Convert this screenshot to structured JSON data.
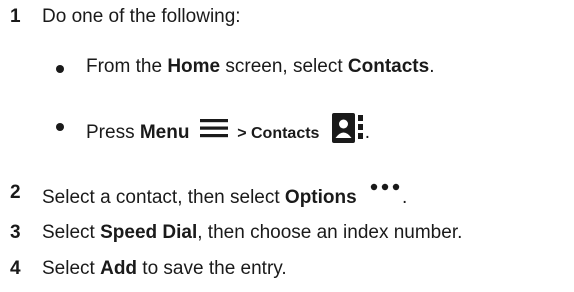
{
  "steps": [
    {
      "number": "1",
      "text": "Do one of the following:",
      "bullets": [
        {
          "prefix": "From the ",
          "bold1": "Home",
          "middle": " screen, select ",
          "bold2": "Contacts",
          "suffix": "."
        },
        {
          "prefix": "Press ",
          "bold1": "Menu",
          "icon1": "hamburger-menu-icon",
          "middle": " > ",
          "bold2": "Contacts",
          "icon2": "contacts-icon",
          "suffix": "."
        }
      ]
    },
    {
      "number": "2",
      "prefix": "Select a contact, then select ",
      "bold": "Options",
      "icon": "more-options-icon",
      "suffix": "."
    },
    {
      "number": "3",
      "prefix": "Select ",
      "bold": "Speed Dial",
      "suffix": ", then choose an index number."
    },
    {
      "number": "4",
      "prefix": "Select ",
      "bold": "Add",
      "suffix": " to save the entry."
    }
  ]
}
